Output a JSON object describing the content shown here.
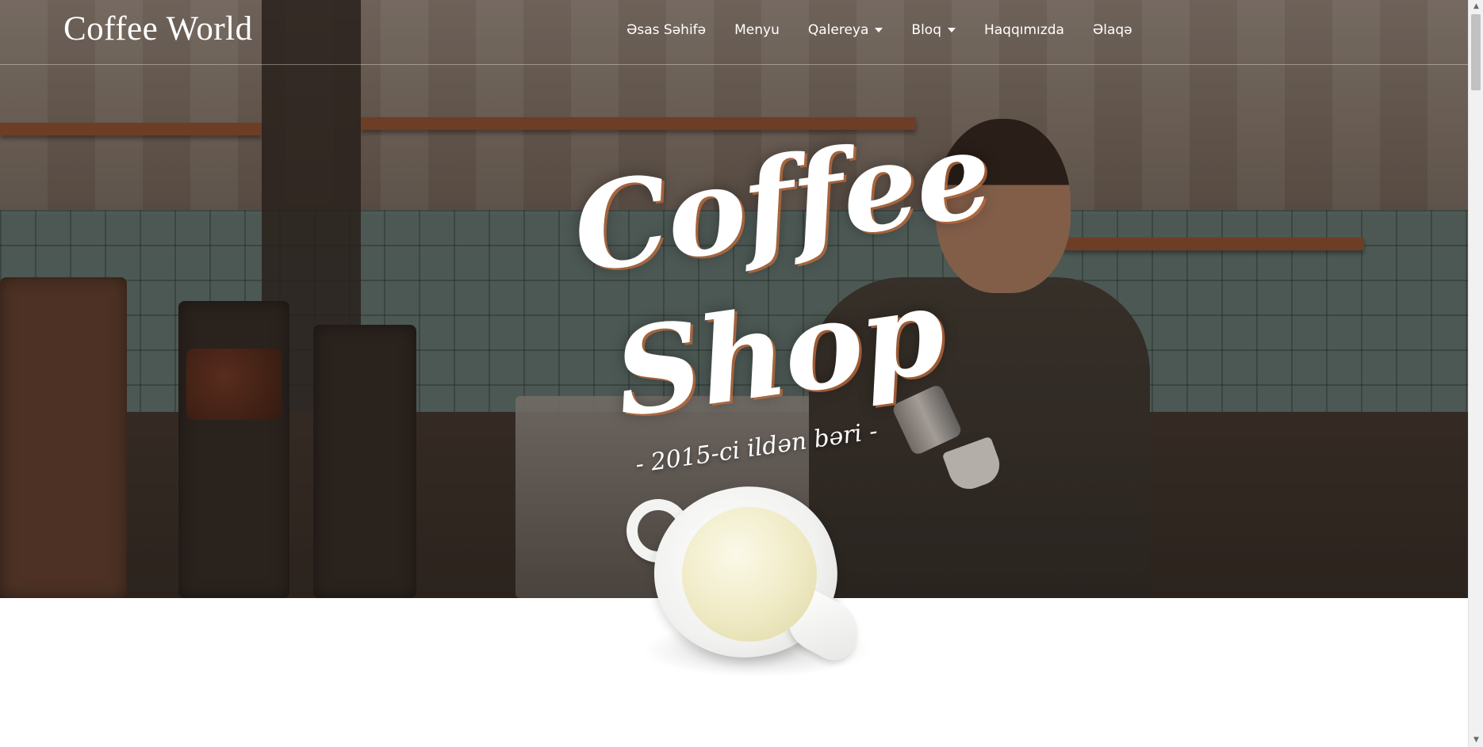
{
  "navbar": {
    "brand": "Coffee World",
    "items": [
      {
        "label": "Əsas Səhifə",
        "dropdown": false
      },
      {
        "label": "Menyu",
        "dropdown": false
      },
      {
        "label": "Qalereya",
        "dropdown": true
      },
      {
        "label": "Bloq",
        "dropdown": true
      },
      {
        "label": "Haqqımızda",
        "dropdown": false
      },
      {
        "label": "Əlaqə",
        "dropdown": false
      }
    ]
  },
  "hero": {
    "title_line_1": "Coffee",
    "title_line_2": "Shop",
    "tagline": "- 2015-ci ildən bəri -"
  },
  "colors": {
    "title_glow": "#c36e3c",
    "text": "#ffffff",
    "page_background": "#ffffff"
  },
  "icons": {
    "caret": "caret-down-icon",
    "scroll_up": "scroll-up-arrow-icon",
    "scroll_down": "scroll-down-arrow-icon"
  }
}
